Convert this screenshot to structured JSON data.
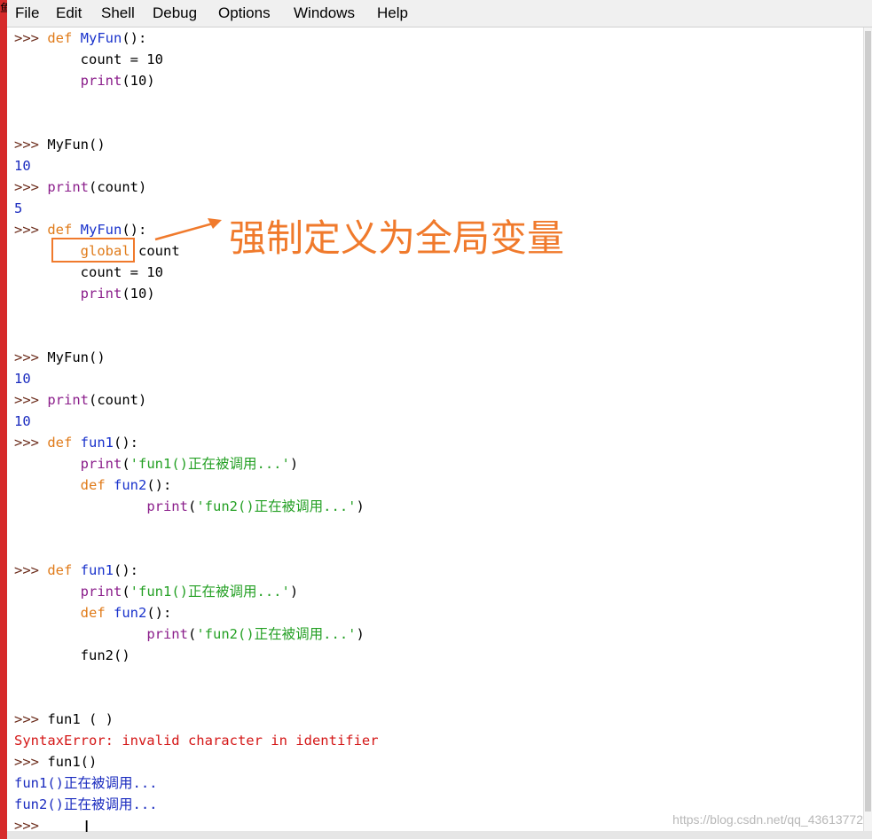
{
  "corner_glyph": "鱼",
  "menu": [
    "File",
    "Edit",
    "Shell",
    "Debug",
    "Options",
    "Windows",
    "Help"
  ],
  "shell_lines": [
    [
      [
        "prompt",
        ">>> "
      ],
      [
        "kw",
        "def"
      ],
      [
        "plain",
        " "
      ],
      [
        "fn",
        "MyFun"
      ],
      [
        "plain",
        "():"
      ]
    ],
    [
      [
        "plain",
        "        count = 10"
      ]
    ],
    [
      [
        "plain",
        "        "
      ],
      [
        "bi",
        "print"
      ],
      [
        "plain",
        "(10)"
      ]
    ],
    [],
    [],
    [
      [
        "prompt",
        ">>> "
      ],
      [
        "plain",
        "MyFun()"
      ]
    ],
    [
      [
        "out",
        "10"
      ]
    ],
    [
      [
        "prompt",
        ">>> "
      ],
      [
        "bi",
        "print"
      ],
      [
        "plain",
        "(count)"
      ]
    ],
    [
      [
        "out",
        "5"
      ]
    ],
    [
      [
        "prompt",
        ">>> "
      ],
      [
        "kw",
        "def"
      ],
      [
        "plain",
        " "
      ],
      [
        "fn",
        "MyFun"
      ],
      [
        "plain",
        "():"
      ]
    ],
    [
      [
        "plain",
        "        "
      ],
      [
        "kw",
        "global"
      ],
      [
        "plain",
        " count"
      ]
    ],
    [
      [
        "plain",
        "        count = 10"
      ]
    ],
    [
      [
        "plain",
        "        "
      ],
      [
        "bi",
        "print"
      ],
      [
        "plain",
        "(10)"
      ]
    ],
    [],
    [],
    [
      [
        "prompt",
        ">>> "
      ],
      [
        "plain",
        "MyFun()"
      ]
    ],
    [
      [
        "out",
        "10"
      ]
    ],
    [
      [
        "prompt",
        ">>> "
      ],
      [
        "bi",
        "print"
      ],
      [
        "plain",
        "(count)"
      ]
    ],
    [
      [
        "out",
        "10"
      ]
    ],
    [
      [
        "prompt",
        ">>> "
      ],
      [
        "kw",
        "def"
      ],
      [
        "plain",
        " "
      ],
      [
        "fn",
        "fun1"
      ],
      [
        "plain",
        "():"
      ]
    ],
    [
      [
        "plain",
        "        "
      ],
      [
        "bi",
        "print"
      ],
      [
        "plain",
        "("
      ],
      [
        "str",
        "'fun1()正在被调用...'"
      ],
      [
        "plain",
        ")"
      ]
    ],
    [
      [
        "plain",
        "        "
      ],
      [
        "kw",
        "def"
      ],
      [
        "plain",
        " "
      ],
      [
        "fn",
        "fun2"
      ],
      [
        "plain",
        "():"
      ]
    ],
    [
      [
        "plain",
        "                "
      ],
      [
        "bi",
        "print"
      ],
      [
        "plain",
        "("
      ],
      [
        "str",
        "'fun2()正在被调用...'"
      ],
      [
        "plain",
        ")"
      ]
    ],
    [],
    [],
    [
      [
        "prompt",
        ">>> "
      ],
      [
        "kw",
        "def"
      ],
      [
        "plain",
        " "
      ],
      [
        "fn",
        "fun1"
      ],
      [
        "plain",
        "():"
      ]
    ],
    [
      [
        "plain",
        "        "
      ],
      [
        "bi",
        "print"
      ],
      [
        "plain",
        "("
      ],
      [
        "str",
        "'fun1()正在被调用...'"
      ],
      [
        "plain",
        ")"
      ]
    ],
    [
      [
        "plain",
        "        "
      ],
      [
        "kw",
        "def"
      ],
      [
        "plain",
        " "
      ],
      [
        "fn",
        "fun2"
      ],
      [
        "plain",
        "():"
      ]
    ],
    [
      [
        "plain",
        "                "
      ],
      [
        "bi",
        "print"
      ],
      [
        "plain",
        "("
      ],
      [
        "str",
        "'fun2()正在被调用...'"
      ],
      [
        "plain",
        ")"
      ]
    ],
    [
      [
        "plain",
        "        fun2()"
      ]
    ],
    [],
    [],
    [
      [
        "prompt",
        ">>> "
      ],
      [
        "plain",
        "fun1 ( )"
      ]
    ],
    [
      [
        "err",
        "SyntaxError: invalid character in identifier"
      ]
    ],
    [
      [
        "prompt",
        ">>> "
      ],
      [
        "plain",
        "fun1()"
      ]
    ],
    [
      [
        "out",
        "fun1()正在被调用..."
      ]
    ],
    [
      [
        "out",
        "fun2()正在被调用..."
      ]
    ],
    [
      [
        "prompt",
        ">>> "
      ]
    ]
  ],
  "annotation": "强制定义为全局变量",
  "watermark": "https://blog.csdn.net/qq_43613772",
  "cursor_glyph": "I",
  "colors": {
    "keyword": "#e07b1a",
    "function_name": "#1a33cc",
    "builtin": "#8b1e8b",
    "string": "#24a024",
    "output": "#1a2bbf",
    "error": "#d41717",
    "prompt": "#6b2b1a",
    "annotation": "#f07a2c"
  }
}
